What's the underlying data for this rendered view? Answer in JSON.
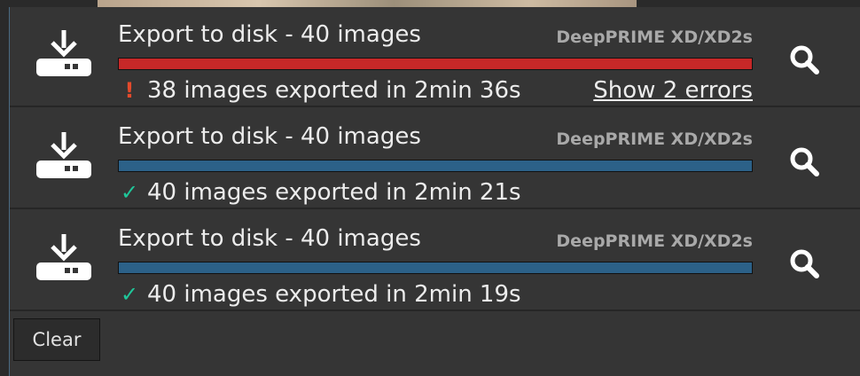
{
  "colors": {
    "error_bar": "#c62828",
    "success_bar": "#2c6188",
    "error_icon": "#e44a2c",
    "success_icon": "#1fc79a"
  },
  "icons": {
    "export": "download-to-disk-icon",
    "search": "magnifier-icon",
    "error": "exclamation-icon",
    "success": "checkmark-icon"
  },
  "jobs": [
    {
      "title": "Export to disk  - 40 images",
      "engine": "DeepPRIME XD/XD2s",
      "progress": 1.0,
      "state": "error",
      "status_symbol": "!",
      "status_text": "38 images exported in 2min 36s",
      "errors_link": "Show 2 errors"
    },
    {
      "title": "Export to disk  - 40 images",
      "engine": "DeepPRIME XD/XD2s",
      "progress": 1.0,
      "state": "success",
      "status_symbol": "✓",
      "status_text": "40 images exported in 2min 21s"
    },
    {
      "title": "Export to disk  - 40 images",
      "engine": "DeepPRIME XD/XD2s",
      "progress": 1.0,
      "state": "success",
      "status_symbol": "✓",
      "status_text": "40 images exported in 2min 19s"
    }
  ],
  "footer": {
    "clear_label": "Clear"
  }
}
